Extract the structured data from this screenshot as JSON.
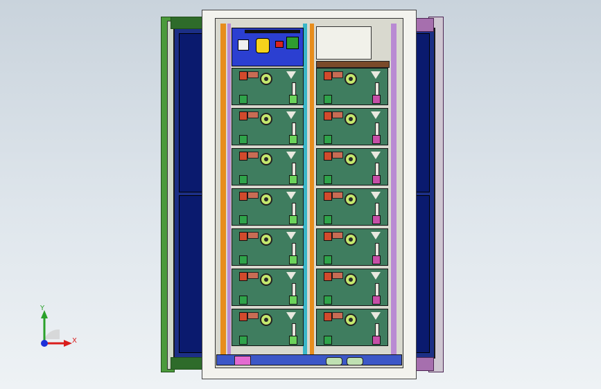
{
  "viewport": {
    "background": "gradient-light-blue-grey"
  },
  "triad": {
    "x_label": "X",
    "y_label": "Y",
    "x_color": "#d91c1c",
    "y_color": "#2aa12a",
    "z_color": "#1c2fd9"
  },
  "model": {
    "name": "battery-cabinet",
    "columns": 2,
    "module_rows": 7,
    "module_color": "#3f7d5f",
    "door_color": "#1c2f86",
    "control_panel_color": "#2b3fd1"
  }
}
